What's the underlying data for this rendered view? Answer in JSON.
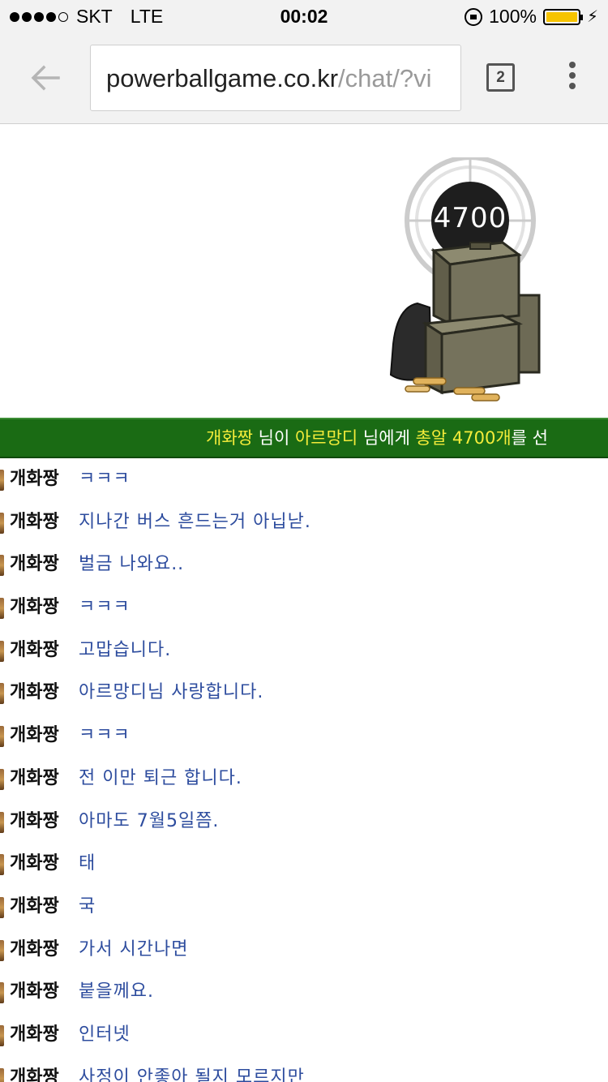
{
  "status_bar": {
    "carrier": "SKT",
    "network": "LTE",
    "time": "00:02",
    "battery": "100%"
  },
  "browser": {
    "url_host": "powerballgame.co.kr",
    "url_path": "/chat/?vi",
    "tab_count": "2"
  },
  "gift": {
    "amount": "4700"
  },
  "ticker": {
    "sender": "개화짱",
    "part1": " 님이 ",
    "receiver": "아르망디",
    "part2": " 님에게 ",
    "item": "총알 4700개",
    "part3": "를 선"
  },
  "chat": {
    "messages": [
      {
        "user": "개화짱",
        "text": "ㅋㅋㅋ"
      },
      {
        "user": "개화짱",
        "text": "지나간 버스 흔드는거 아닙낟."
      },
      {
        "user": "개화짱",
        "text": "벌금 나와요.."
      },
      {
        "user": "개화짱",
        "text": "ㅋㅋㅋ"
      },
      {
        "user": "개화짱",
        "text": "고맙습니다."
      },
      {
        "user": "개화짱",
        "text": "아르망디님 사랑합니다."
      },
      {
        "user": "개화짱",
        "text": "ㅋㅋㅋ"
      },
      {
        "user": "개화짱",
        "text": "전 이만 퇴근 합니다."
      },
      {
        "user": "개화짱",
        "text": "아마도 7월5일쯤."
      },
      {
        "user": "개화짱",
        "text": "태"
      },
      {
        "user": "개화짱",
        "text": "국"
      },
      {
        "user": "개화짱",
        "text": "가서 시간나면"
      },
      {
        "user": "개화짱",
        "text": "붙을께요."
      },
      {
        "user": "개화짱",
        "text": "인터넷"
      },
      {
        "user": "개화짱",
        "text": "사정이 안좋아 될지 모르지만"
      }
    ]
  }
}
